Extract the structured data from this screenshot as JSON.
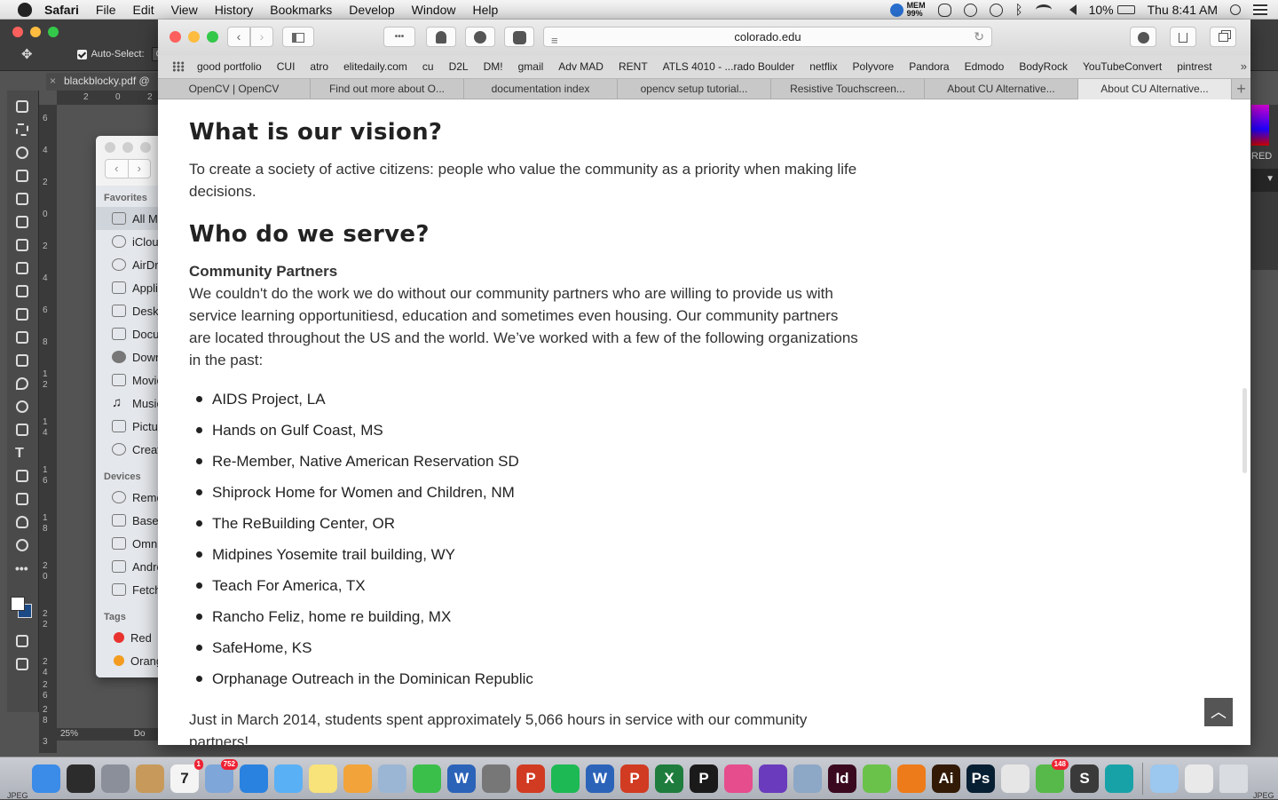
{
  "menubar": {
    "app": "Safari",
    "items": [
      "File",
      "Edit",
      "View",
      "History",
      "Bookmarks",
      "Develop",
      "Window",
      "Help"
    ],
    "mem_label": "MEM",
    "mem_value": "99%",
    "battery": "10%",
    "clock": "Thu 8:41 AM"
  },
  "photoshop": {
    "auto_select_label": "Auto-Select:",
    "auto_select_value": "Gr",
    "doc_tab": "blackblocky.pdf @",
    "ruler_h": [
      "2",
      "0",
      "2"
    ],
    "ruler_v": [
      "6",
      "4",
      "2",
      "0",
      "2",
      "4",
      "6",
      "8",
      "1",
      "2",
      "1",
      "4",
      "1",
      "6",
      "1",
      "8",
      "2",
      "0",
      "2",
      "2",
      "2",
      "4",
      "2",
      "6",
      "2",
      "8",
      "3"
    ],
    "zoom": "25%",
    "doc_info": "Do",
    "right_label": "RED"
  },
  "finder": {
    "favorites_label": "Favorites",
    "favorites": [
      "All My",
      "iCloud",
      "AirDrop",
      "Applications",
      "Desktop",
      "Documents",
      "Downloads",
      "Movies",
      "Music",
      "Pictures",
      "Creative"
    ],
    "devices_label": "Devices",
    "devices": [
      "Remote",
      "Base",
      "Omni",
      "Android",
      "Fetch"
    ],
    "tags_label": "Tags",
    "tags": [
      {
        "label": "Red",
        "color": "#e8322e"
      },
      {
        "label": "Orange",
        "color": "#f39c1f"
      }
    ]
  },
  "safari": {
    "url": "colorado.edu",
    "favorites": [
      "good portfolio",
      "CUI",
      "atro",
      "elitedaily.com",
      "cu",
      "D2L",
      "DM!",
      "gmail",
      "Adv MAD",
      "RENT",
      "ATLS 4010 - ...rado Boulder",
      "netflix",
      "Polyvore",
      "Pandora",
      "Edmodo",
      "BodyRock",
      "YouTubeConvert",
      "pintrest"
    ],
    "tabs": [
      "OpenCV | OpenCV",
      "Find out more about O...",
      "documentation index",
      "opencv setup tutorial...",
      "Resistive Touchscreen...",
      "About CU Alternative...",
      "About CU Alternative..."
    ]
  },
  "page": {
    "vision_heading": "What is our vision?",
    "vision_text": "To create a society of active citizens: people who value the community as a priority when making life decisions.",
    "serve_heading": "Who do we serve?",
    "partners_label": "Community Partners",
    "partners_text": "We couldn't do the work we do without our community partners who are willing to provide us with service learning opportunitiesd, education and sometimes even housing. Our community partners are located throughout the US and the world.  We’ve worked with a few of the following organizations in the past:",
    "orgs": [
      "AIDS Project, LA",
      "Hands on Gulf Coast, MS",
      "Re-Member, Native American Reservation SD",
      "Shiprock Home for Women and Children, NM",
      "The ReBuilding Center, OR",
      "Midpines Yosemite trail building, WY",
      "Teach For America, TX",
      "Rancho Feliz, home re building, MX",
      "SafeHome, KS",
      "Orphanage Outreach in the Dominican Republic"
    ],
    "march_text": "Just in March 2014, students spent approximately 5,066 hours in service with our community partners!"
  },
  "dock": {
    "apps": [
      {
        "name": "finder",
        "color": "#3b8be8",
        "glyph": ""
      },
      {
        "name": "dashboard",
        "color": "#2c2c2c",
        "glyph": ""
      },
      {
        "name": "launchpad",
        "color": "#8a8f99",
        "glyph": ""
      },
      {
        "name": "contacts",
        "color": "#c79a5c",
        "glyph": ""
      },
      {
        "name": "calendar",
        "color": "#f4f4f4",
        "glyph": "7",
        "badge": "1"
      },
      {
        "name": "preview",
        "color": "#7ea6d8",
        "glyph": "",
        "badge": "752"
      },
      {
        "name": "safari",
        "color": "#2a82e0",
        "glyph": ""
      },
      {
        "name": "messages",
        "color": "#5ab0f4",
        "glyph": ""
      },
      {
        "name": "notes",
        "color": "#f8e27a",
        "glyph": ""
      },
      {
        "name": "photos",
        "color": "#f2a33a",
        "glyph": ""
      },
      {
        "name": "image-capture",
        "color": "#9bb6d4",
        "glyph": ""
      },
      {
        "name": "facetime",
        "color": "#3bbf4b",
        "glyph": ""
      },
      {
        "name": "word",
        "color": "#2b63b8",
        "glyph": "W"
      },
      {
        "name": "system-preferences",
        "color": "#777",
        "glyph": ""
      },
      {
        "name": "powerpoint",
        "color": "#d13b22",
        "glyph": "P"
      },
      {
        "name": "spotify",
        "color": "#1db954",
        "glyph": ""
      },
      {
        "name": "word-2",
        "color": "#2b63b8",
        "glyph": "W"
      },
      {
        "name": "powerpoint-2",
        "color": "#d13b22",
        "glyph": "P"
      },
      {
        "name": "excel",
        "color": "#1e7d3d",
        "glyph": "X"
      },
      {
        "name": "pandora",
        "color": "#1a1a1a",
        "glyph": "P"
      },
      {
        "name": "itunes",
        "color": "#e64d8c",
        "glyph": ""
      },
      {
        "name": "imovie",
        "color": "#6a3bbd",
        "glyph": ""
      },
      {
        "name": "app-store",
        "color": "#8da7c6",
        "glyph": ""
      },
      {
        "name": "indesign",
        "color": "#3a0920",
        "glyph": "Id"
      },
      {
        "name": "sketchbook",
        "color": "#6ac24a",
        "glyph": ""
      },
      {
        "name": "vlc",
        "color": "#ee7b1a",
        "glyph": ""
      },
      {
        "name": "illustrator",
        "color": "#321a06",
        "glyph": "Ai"
      },
      {
        "name": "photoshop",
        "color": "#071f33",
        "glyph": "Ps"
      },
      {
        "name": "chrome",
        "color": "#e6e6e6",
        "glyph": ""
      },
      {
        "name": "evernote",
        "color": "#57b94a",
        "glyph": "",
        "badge": "148"
      },
      {
        "name": "sublime",
        "color": "#3a3a3a",
        "glyph": "S"
      },
      {
        "name": "arduino",
        "color": "#17a2a8",
        "glyph": ""
      }
    ],
    "jpeg_label": "JPEG"
  }
}
